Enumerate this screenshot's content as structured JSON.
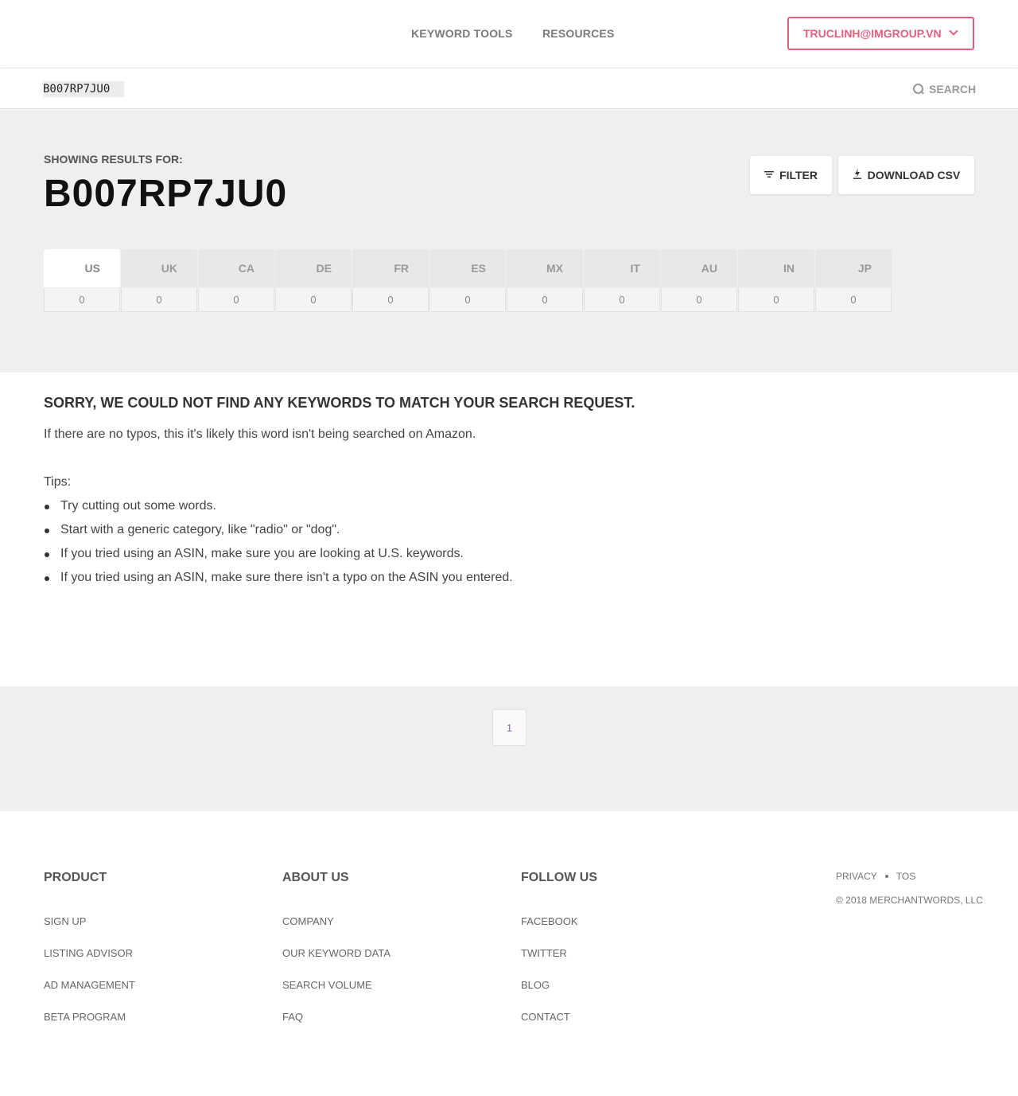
{
  "header": {
    "nav": [
      "KEYWORD TOOLS",
      "RESOURCES"
    ],
    "account_label": "TRUCLINH@IMGROUP.VN"
  },
  "search": {
    "value": "B007RP7JU0",
    "button_label": "SEARCH"
  },
  "results": {
    "showing_label": "SHOWING RESULTS FOR:",
    "term": "B007RP7JU0",
    "filter_label": "FILTER",
    "csv_label": "DOWNLOAD CSV",
    "countries": [
      {
        "code": "US",
        "count": "0",
        "active": true
      },
      {
        "code": "UK",
        "count": "0"
      },
      {
        "code": "CA",
        "count": "0"
      },
      {
        "code": "DE",
        "count": "0"
      },
      {
        "code": "FR",
        "count": "0"
      },
      {
        "code": "ES",
        "count": "0"
      },
      {
        "code": "MX",
        "count": "0"
      },
      {
        "code": "IT",
        "count": "0"
      },
      {
        "code": "AU",
        "count": "0"
      },
      {
        "code": "IN",
        "count": "0"
      },
      {
        "code": "JP",
        "count": "0"
      }
    ]
  },
  "message": {
    "title": "SORRY, WE COULD NOT FIND ANY KEYWORDS TO MATCH YOUR SEARCH REQUEST.",
    "text": "If there are no typos, this it's likely this word isn't being searched on Amazon.",
    "tips_label": "Tips:",
    "tips": [
      "Try cutting out some words.",
      "Start with a generic category, like \"radio\" or \"dog\".",
      "If you tried using an ASIN, make sure you are looking at U.S. keywords.",
      "If you tried using an ASIN, make sure there isn't a typo on the ASIN you entered."
    ]
  },
  "pagination": {
    "current": "1"
  },
  "footer": {
    "product": {
      "title": "PRODUCT",
      "links": [
        "SIGN UP",
        "LISTING ADVISOR",
        "AD MANAGEMENT",
        "BETA PROGRAM"
      ]
    },
    "about": {
      "title": "ABOUT US",
      "links": [
        "COMPANY",
        "OUR KEYWORD DATA",
        "SEARCH VOLUME",
        "FAQ"
      ]
    },
    "follow": {
      "title": "FOLLOW US",
      "links": [
        "FACEBOOK",
        "TWITTER",
        "BLOG",
        "CONTACT"
      ]
    },
    "privacy": "PRIVACY",
    "tos": "TOS",
    "copyright": "© 2018 MERCHANTWORDS, LLC"
  },
  "colors": {
    "accent": "#e0607e",
    "band": "#efefef"
  },
  "icons": [
    "chevron-down-icon",
    "search-icon",
    "filter-icon",
    "download-icon"
  ]
}
